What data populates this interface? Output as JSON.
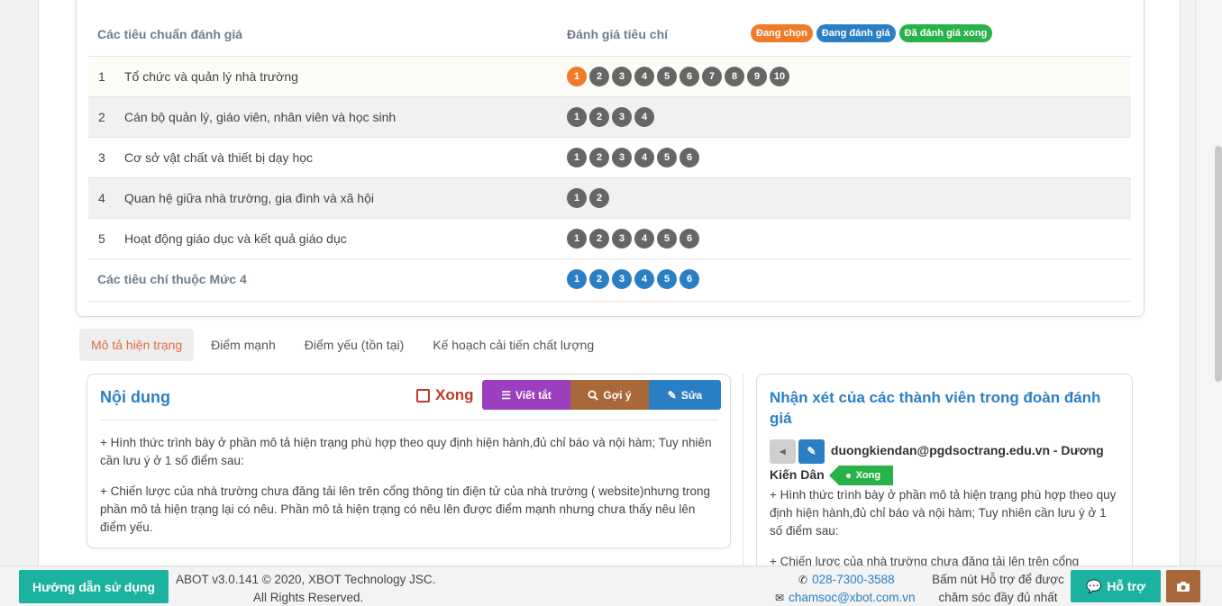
{
  "criteria": {
    "header_standards": "Các tiêu chuẩn đánh giá",
    "header_rating": "Đánh giá tiêu chí",
    "legend": [
      {
        "label": "Đang chọn",
        "color": "#ef7b2a"
      },
      {
        "label": "Đang đánh giá",
        "color": "#2a7fc4"
      },
      {
        "label": "Đã đánh giá xong",
        "color": "#2ab24a"
      }
    ],
    "rows": [
      {
        "num": "1",
        "name": "Tổ chức và quản lý nhà trường",
        "dots": [
          "1",
          "2",
          "3",
          "4",
          "5",
          "6",
          "7",
          "8",
          "9",
          "10"
        ]
      },
      {
        "num": "2",
        "name": "Cán bộ quản lý, giáo viên, nhân viên và học sinh",
        "dots": [
          "1",
          "2",
          "3",
          "4"
        ]
      },
      {
        "num": "3",
        "name": "Cơ sở vật chất và thiết bị dạy học",
        "dots": [
          "1",
          "2",
          "3",
          "4",
          "5",
          "6"
        ]
      },
      {
        "num": "4",
        "name": "Quan hệ giữa nhà trường, gia đình và xã hội",
        "dots": [
          "1",
          "2"
        ]
      },
      {
        "num": "5",
        "name": "Hoạt động giáo dục và kết quả giáo dục",
        "dots": [
          "1",
          "2",
          "3",
          "4",
          "5",
          "6"
        ]
      }
    ],
    "level4_label": "Các tiêu chí thuộc Mức 4",
    "level4_dots": [
      "1",
      "2",
      "3",
      "4",
      "5",
      "6"
    ]
  },
  "tabs": [
    {
      "label": "Mô tả hiện trạng",
      "active": true
    },
    {
      "label": "Điểm mạnh",
      "active": false
    },
    {
      "label": "Điểm yếu (tồn tại)",
      "active": false
    },
    {
      "label": "Kế hoạch cải tiến chất lượng",
      "active": false
    }
  ],
  "content": {
    "title": "Nội dung",
    "done_label": "Xong",
    "btn_abbrev": "Viết tắt",
    "btn_suggest": "Gợi ý",
    "btn_edit": "Sửa",
    "paragraphs": [
      "+ Hình thức trình bày ở phần mô tả hiện trạng phù hợp theo quy định hiện hành,đủ  chỉ báo và nội hàm; Tuy nhiên cần lưu ý ở 1 số điểm sau:",
      "+ Chiến lược của nhà trường chưa đăng tải lên trên cổng thông tin điện tử của nhà trường ( website)nhưng trong phần mô tả hiện trạng lại có nêu. Phần mô tả hiện  trạng có nêu lên được điểm mạnh nhưng chưa thấy nêu lên điểm yếu."
    ]
  },
  "comments": {
    "title": "Nhận xét của các thành viên trong đoàn đánh giá",
    "author": "duongkiendan@pgdsoctrang.edu.vn - Dương Kiến Dân",
    "status": "Xong",
    "paragraphs": [
      "+ Hình thức trình bày ở phần mô tả hiện trạng phù hợp theo quy định hiện hành,đủ  chỉ báo và nội hàm; Tuy nhiên cần lưu ý ở 1 số điểm sau:",
      "+ Chiến lược của nhà trường chưa đăng tải lên trên cổng"
    ]
  },
  "footer": {
    "help_label": "Hướng dẫn sử dụng",
    "copyright_line1": "ABOT v3.0.141 © 2020, XBOT Technology JSC.",
    "copyright_line2": "All Rights Reserved.",
    "phone": "028-7300-3588",
    "email": "chamsoc@xbot.com.vn",
    "support_text_line1": "Bấm nút Hỗ trợ để được",
    "support_text_line2": "chăm sóc đầy đủ nhất",
    "support_label": "Hỗ trợ"
  }
}
